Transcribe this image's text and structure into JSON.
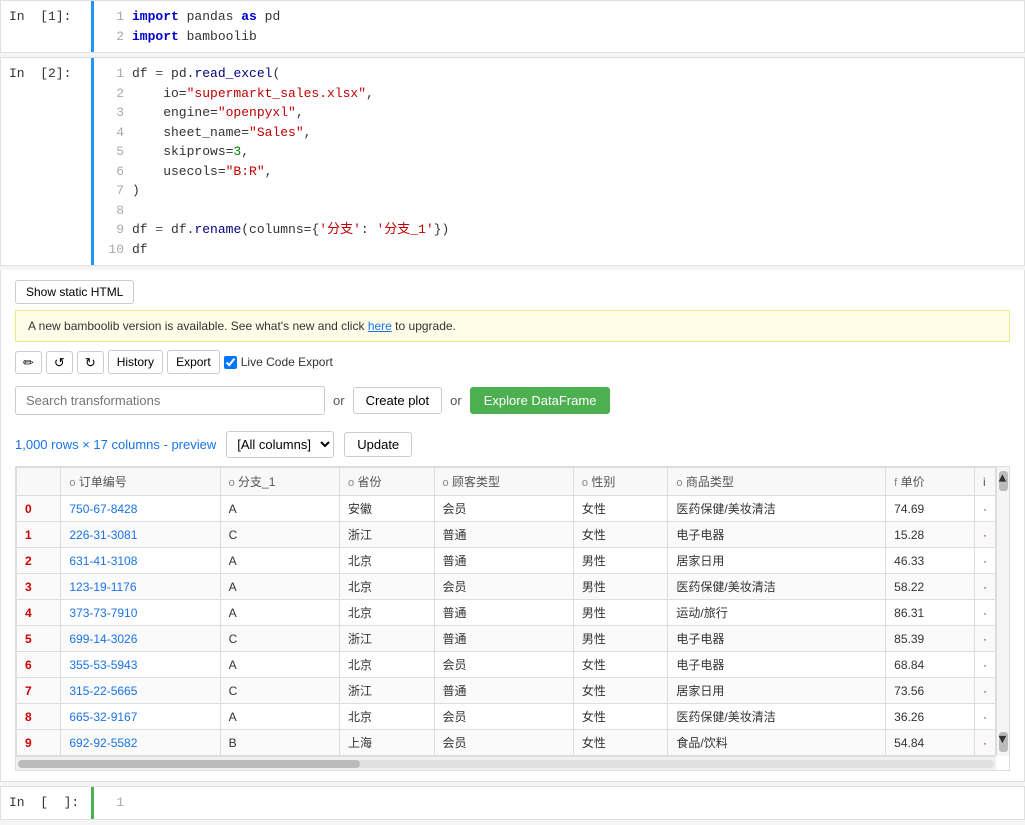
{
  "cells": [
    {
      "id": "cell1",
      "label": "In  [1]:",
      "code_lines": [
        {
          "num": 1,
          "tokens": [
            {
              "type": "kw",
              "text": "import"
            },
            {
              "type": "var",
              "text": " pandas "
            },
            {
              "type": "kw",
              "text": "as"
            },
            {
              "type": "var",
              "text": " pd"
            }
          ]
        },
        {
          "num": 2,
          "tokens": [
            {
              "type": "kw",
              "text": "import"
            },
            {
              "type": "var",
              "text": " bamboolib"
            }
          ]
        }
      ]
    },
    {
      "id": "cell2",
      "label": "In  [2]:",
      "code_lines": [
        {
          "num": 1,
          "raw": "df = pd.read_excel("
        },
        {
          "num": 2,
          "raw": "    io=\"supermarkt_sales.xlsx\","
        },
        {
          "num": 3,
          "raw": "    engine=\"openpyxl\","
        },
        {
          "num": 4,
          "raw": "    sheet_name=\"Sales\","
        },
        {
          "num": 5,
          "raw": "    skiprows=3,"
        },
        {
          "num": 6,
          "raw": "    usecols=\"B:R\","
        },
        {
          "num": 7,
          "raw": ")"
        },
        {
          "num": 8,
          "raw": ""
        },
        {
          "num": 9,
          "raw": "df = df.rename(columns={'分支': '分支_1'})"
        },
        {
          "num": 10,
          "raw": "df"
        }
      ]
    }
  ],
  "output": {
    "show_html_btn": "Show static HTML",
    "upgrade_banner": "A new bamboolib version is available. See what's new and click here to upgrade.",
    "upgrade_link_text": "here",
    "toolbar": {
      "pencil_icon": "✏",
      "undo_icon": "↺",
      "redo_icon": "↻",
      "history_label": "History",
      "export_label": "Export",
      "live_code_label": "Live Code Export"
    },
    "search_placeholder": "Search transformations",
    "or_label1": "or",
    "or_label2": "or",
    "create_plot_btn": "Create plot",
    "explore_btn": "Explore DataFrame",
    "rows_info": "1,000 rows × 17 columns - preview",
    "col_select": "[All columns]",
    "update_btn": "Update",
    "table": {
      "headers": [
        {
          "label": "",
          "type": ""
        },
        {
          "label": "订单编号",
          "type": "o"
        },
        {
          "label": "分支_1",
          "type": "o"
        },
        {
          "label": "省份",
          "type": "o"
        },
        {
          "label": "顾客类型",
          "type": "o"
        },
        {
          "label": "性别",
          "type": "o"
        },
        {
          "label": "商品类型",
          "type": "o"
        },
        {
          "label": "单价",
          "type": "f"
        },
        {
          "label": "i",
          "type": ""
        }
      ],
      "rows": [
        {
          "idx": "0",
          "order_id": "750-67-8428",
          "branch": "A",
          "province": "安徽",
          "customer": "会员",
          "gender": "女性",
          "product": "医药保健/美妆清洁",
          "price": "74.69"
        },
        {
          "idx": "1",
          "order_id": "226-31-3081",
          "branch": "C",
          "province": "浙江",
          "customer": "普通",
          "gender": "女性",
          "product": "电子电器",
          "price": "15.28"
        },
        {
          "idx": "2",
          "order_id": "631-41-3108",
          "branch": "A",
          "province": "北京",
          "customer": "普通",
          "gender": "男性",
          "product": "居家日用",
          "price": "46.33"
        },
        {
          "idx": "3",
          "order_id": "123-19-1176",
          "branch": "A",
          "province": "北京",
          "customer": "会员",
          "gender": "男性",
          "product": "医药保健/美妆清洁",
          "price": "58.22"
        },
        {
          "idx": "4",
          "order_id": "373-73-7910",
          "branch": "A",
          "province": "北京",
          "customer": "普通",
          "gender": "男性",
          "product": "运动/旅行",
          "price": "86.31"
        },
        {
          "idx": "5",
          "order_id": "699-14-3026",
          "branch": "C",
          "province": "浙江",
          "customer": "普通",
          "gender": "男性",
          "product": "电子电器",
          "price": "85.39"
        },
        {
          "idx": "6",
          "order_id": "355-53-5943",
          "branch": "A",
          "province": "北京",
          "customer": "会员",
          "gender": "女性",
          "product": "电子电器",
          "price": "68.84"
        },
        {
          "idx": "7",
          "order_id": "315-22-5665",
          "branch": "C",
          "province": "浙江",
          "customer": "普通",
          "gender": "女性",
          "product": "居家日用",
          "price": "73.56"
        },
        {
          "idx": "8",
          "order_id": "665-32-9167",
          "branch": "A",
          "province": "北京",
          "customer": "会员",
          "gender": "女性",
          "product": "医药保健/美妆清洁",
          "price": "36.26"
        },
        {
          "idx": "9",
          "order_id": "692-92-5582",
          "branch": "B",
          "province": "上海",
          "customer": "会员",
          "gender": "女性",
          "product": "食品/饮料",
          "price": "54.84"
        }
      ]
    }
  },
  "empty_cell": {
    "label": "In  [ ]:",
    "line_num": "1"
  }
}
